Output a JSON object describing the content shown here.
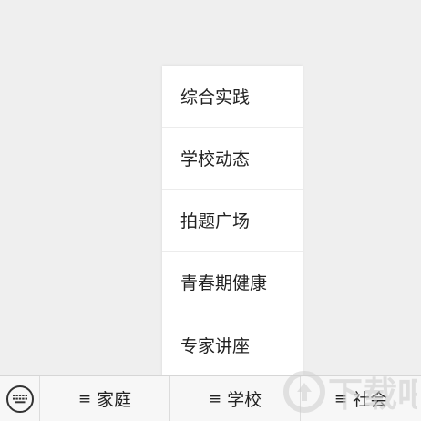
{
  "menu": {
    "items": [
      {
        "label": "综合实践"
      },
      {
        "label": "学校动态"
      },
      {
        "label": "拍题广场"
      },
      {
        "label": "青春期健康"
      },
      {
        "label": "专家讲座"
      }
    ]
  },
  "bottom_bar": {
    "keyboard_icon": "keyboard-icon",
    "tab_icon": "menu-lines-icon",
    "tab_glyph": "≡",
    "tabs": [
      {
        "label": "家庭"
      },
      {
        "label": "学校"
      },
      {
        "label": "社会"
      }
    ]
  },
  "watermark": {
    "text": "下载吧",
    "color": "#cfcfcf"
  }
}
